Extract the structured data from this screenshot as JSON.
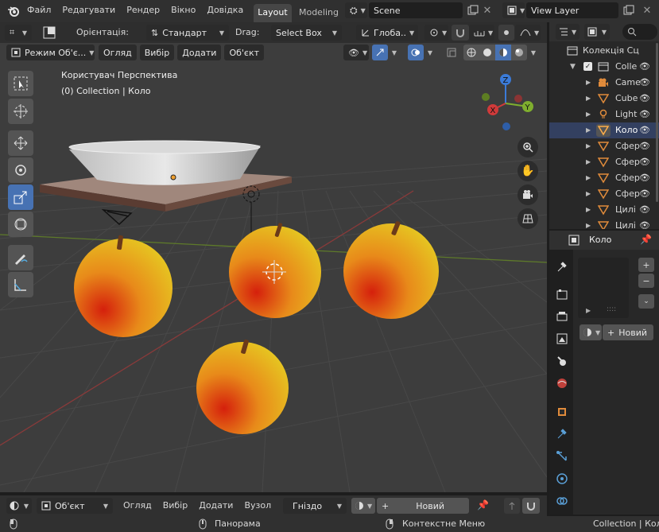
{
  "topbar": {
    "menus": [
      "Файл",
      "Редагувати",
      "Рендер",
      "Вікно",
      "Довідка"
    ],
    "workspace_tabs": [
      "Layout",
      "Modeling"
    ],
    "scene_name": "Scene",
    "view_layer_name": "View Layer"
  },
  "tool_header": {
    "orientation_label": "Орієнтація:",
    "orientation_value": "Стандарт",
    "drag_label": "Drag:",
    "drag_value": "Select Box",
    "transform_orientation": "Глоба..",
    "pivot_icon": "pivot-icon"
  },
  "viewport_header": {
    "mode": "Режим Об'є...",
    "menus": [
      "Огляд",
      "Вибір",
      "Додати",
      "Об'єкт"
    ]
  },
  "viewport": {
    "view_name": "Користувач Перспектива",
    "collection_info": "(0) Collection | Коло",
    "gizmo_axes": {
      "z": "Z",
      "y": "Y",
      "x": "X"
    }
  },
  "outliner": {
    "title": "Колекція Сц",
    "items": [
      {
        "label": "Colle",
        "icon": "collection-icon"
      },
      {
        "label": "Came",
        "icon": "camera-icon"
      },
      {
        "label": "Cube",
        "icon": "mesh-icon"
      },
      {
        "label": "Light",
        "icon": "light-icon"
      },
      {
        "label": "Коло",
        "icon": "mesh-icon"
      },
      {
        "label": "Сфер",
        "icon": "mesh-icon"
      },
      {
        "label": "Сфер",
        "icon": "mesh-icon"
      },
      {
        "label": "Сфер",
        "icon": "mesh-icon"
      },
      {
        "label": "Сфер",
        "icon": "mesh-icon"
      },
      {
        "label": "Цилі",
        "icon": "mesh-icon"
      },
      {
        "label": "Цилі",
        "icon": "mesh-icon"
      }
    ]
  },
  "properties": {
    "object_name": "Коло",
    "new_material_label": "Новий",
    "add_label": "+",
    "remove_label": "−"
  },
  "timeline_header": {
    "mode": "Об'єкт",
    "menus": [
      "Огляд",
      "Вибір",
      "Додати",
      "Вузол"
    ],
    "slot": "Гніздо",
    "new_label": "Новий"
  },
  "statusbar": {
    "pan_label": "Панорама",
    "context_label": "Контекстне Меню",
    "right_info": "Collection | Коло"
  },
  "colors": {
    "header_bg": "#303030",
    "viewport_bg": "#3d3d3d",
    "active_blue": "#4772b3",
    "fruit_yellow": "#e6c21f",
    "fruit_red": "#d5200c"
  }
}
